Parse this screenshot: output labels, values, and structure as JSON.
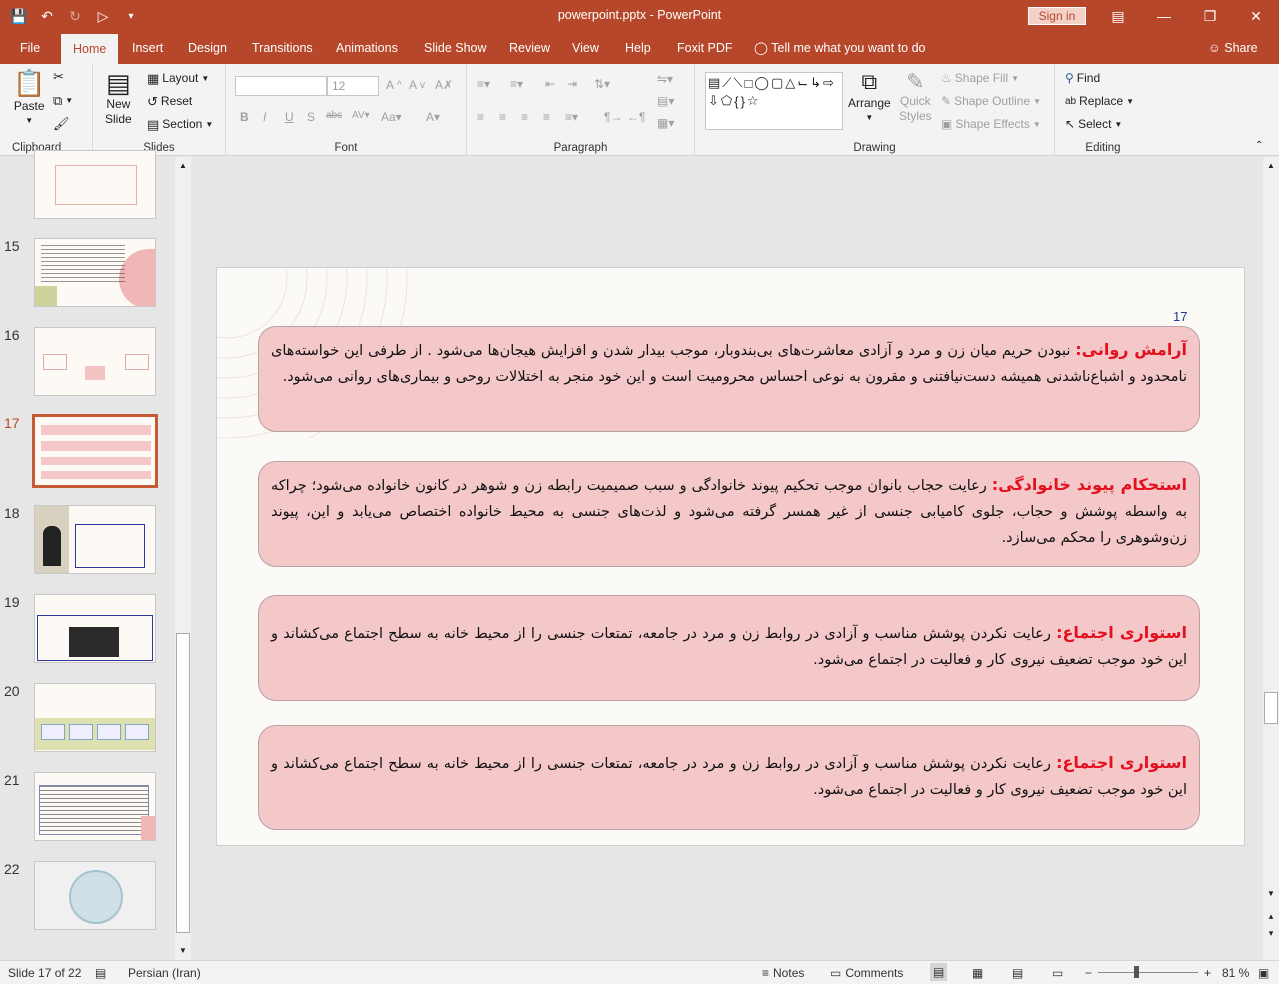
{
  "window": {
    "title": "powerpoint.pptx  -  PowerPoint",
    "sign_in": "Sign in"
  },
  "tabs": [
    "File",
    "Home",
    "Insert",
    "Design",
    "Transitions",
    "Animations",
    "Slide Show",
    "Review",
    "View",
    "Help",
    "Foxit PDF"
  ],
  "tell_me": "Tell me what you want to do",
  "share": "Share",
  "ribbon": {
    "clipboard": {
      "label": "Clipboard",
      "paste": "Paste"
    },
    "slides": {
      "label": "Slides",
      "new_slide_1": "New",
      "new_slide_2": "Slide",
      "layout": "Layout",
      "reset": "Reset",
      "section": "Section"
    },
    "font": {
      "label": "Font",
      "size": "12"
    },
    "paragraph": {
      "label": "Paragraph"
    },
    "drawing": {
      "label": "Drawing",
      "arrange": "Arrange",
      "quick_styles_1": "Quick",
      "quick_styles_2": "Styles",
      "shape_fill": "Shape Fill",
      "shape_outline": "Shape Outline",
      "shape_effects": "Shape Effects"
    },
    "editing": {
      "label": "Editing",
      "find": "Find",
      "replace": "Replace",
      "select": "Select"
    }
  },
  "thumbnails": [
    {
      "num": "15"
    },
    {
      "num": "16"
    },
    {
      "num": "17"
    },
    {
      "num": "18"
    },
    {
      "num": "19"
    },
    {
      "num": "20"
    },
    {
      "num": "21"
    },
    {
      "num": "22"
    }
  ],
  "slide": {
    "number": "17",
    "boxes": [
      {
        "heading": "آرامش روانی:",
        "text": " نبودن حریم میان زن و مرد و آزادی معاشرت‌های بی‌بندوبار، موجب بیدار شدن و افزایش هیجان‌ها می‌شود . از طرفی این خواسته‌های نامحدود و اشباع‌ناشدنی همیشه دست‌نیافتنی و مقرون به نوعی احساس محرومیت است و این خود منجر به اختلالات روحی و بیماری‌های روانی می‌شود."
      },
      {
        "heading": "استحکام پیوند خانوادگی:",
        "text": " رعایت حجاب بانوان موجب تحکیم پیوند خانوادگی و سبب صمیمیت رابطه زن و شوهر در کانون خانواده می‌شود؛ چراکه به واسطه پوشش و حجاب، جلوی کامیابی جنسی از غیر همسر گرفته می‌شود و لذت‌های جنسی به محیط خانواده اختصاص می‌یابد و این، پیوند زن‌وشوهری را محکم می‌سازد."
      },
      {
        "heading": "استواری اجتماع:",
        "text": " رعایت نکردن پوشش مناسب و آزادی در روابط زن و مرد در جامعه، تمتعات جنسی را از محیط خانه به سطح اجتماع می‌کشاند و این خود موجب تضعیف نیروی کار و فعالیت در اجتماع می‌شود."
      },
      {
        "heading": "استواری اجتماع:",
        "text": " رعایت نکردن پوشش مناسب و آزادی در روابط زن و مرد در جامعه، تمتعات جنسی را از محیط خانه به سطح اجتماع می‌کشاند و این خود موجب تضعیف نیروی کار و فعالیت در اجتماع می‌شود."
      }
    ]
  },
  "status": {
    "slide_of": "Slide 17 of 22",
    "language": "Persian (Iran)",
    "notes": "Notes",
    "comments": "Comments",
    "zoom": "81 %"
  },
  "colors": {
    "accent": "#b7472a",
    "box_fill": "#f4c7c9",
    "heading_red": "#e3101e"
  }
}
